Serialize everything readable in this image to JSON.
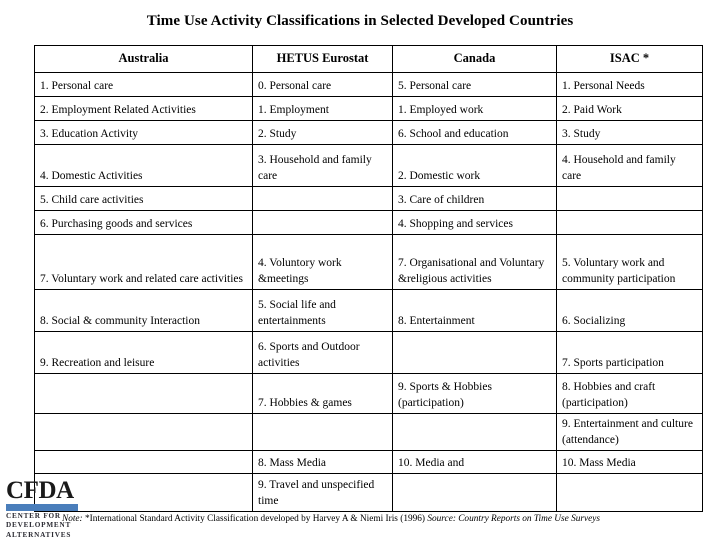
{
  "slide": {
    "title": "Time Use Activity Classifications in Selected Developed Countries"
  },
  "table": {
    "headers": [
      "Australia",
      "HETUS Eurostat",
      "Canada",
      "ISAC  *"
    ],
    "rows": [
      {
        "australia": "1. Personal care",
        "hetus": "0. Personal care",
        "canada": "5. Personal care",
        "isac": "1. Personal Needs"
      },
      {
        "australia": "2. Employment Related Activities",
        "hetus": "1. Employment",
        "canada": "1. Employed work",
        "isac": "2. Paid Work"
      },
      {
        "australia": "3. Education Activity",
        "hetus": "2. Study",
        "canada": "6. School and education",
        "isac": "3. Study"
      },
      {
        "australia": "4. Domestic Activities",
        "hetus": "3. Household and family care",
        "canada": "2. Domestic work",
        "isac": "4. Household and family care"
      },
      {
        "australia": "5. Child care activities",
        "hetus": "",
        "canada": "3. Care of children",
        "isac": ""
      },
      {
        "australia": "6. Purchasing goods and services",
        "hetus": "",
        "canada": "4. Shopping and services",
        "isac": ""
      },
      {
        "australia": "7. Voluntary work and related care activities",
        "hetus": "4. Voluntory work &meetings",
        "canada": "7. Organisational and Voluntary &religious activities",
        "isac": "5. Voluntary work and community participation"
      },
      {
        "australia": "8. Social & community Interaction",
        "hetus": "5. Social life and entertainments",
        "canada": "8. Entertainment",
        "isac": "6. Socializing"
      },
      {
        "australia": "9. Recreation and leisure",
        "hetus": "6. Sports and Outdoor activities",
        "canada": "",
        "isac": "7. Sports participation"
      },
      {
        "australia": "",
        "hetus": "7. Hobbies & games",
        "canada": "9. Sports & Hobbies (participation)",
        "isac": "8. Hobbies and craft (participation)"
      },
      {
        "australia": "",
        "hetus": "",
        "canada": "",
        "isac": "9. Entertainment and culture (attendance)"
      },
      {
        "australia": "",
        "hetus": "8. Mass Media",
        "canada": "10. Media and",
        "isac": "10. Mass Media"
      },
      {
        "australia": "",
        "hetus": "9. Travel and unspecified time",
        "canada": "",
        "isac": ""
      }
    ]
  },
  "logo": {
    "wordmark": "CFDA",
    "line1": "CENTER FOR",
    "line2": "DEVELOPMENT",
    "line3": "ALTERNATIVES",
    "bar_color": "#4a7ebb"
  },
  "footnote": {
    "note_label": "Note:",
    "note_text": " *International Standard Activity Classification developed by Harvey A & Niemi Iris (1996) ",
    "source_text": "Source: Country Reports on Time Use Surveys"
  }
}
